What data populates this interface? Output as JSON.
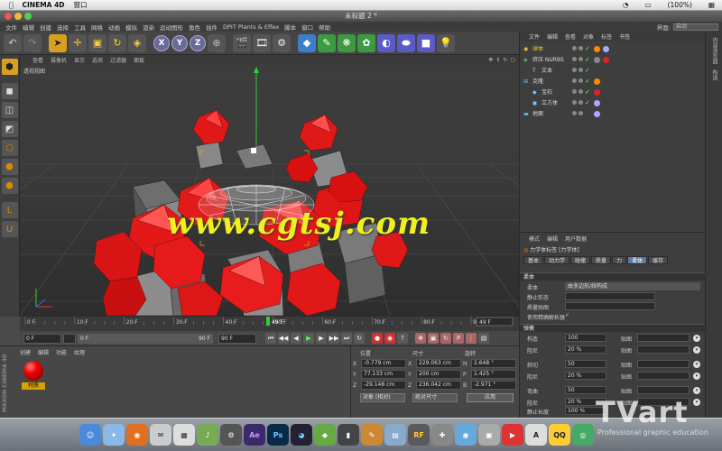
{
  "menubar": {
    "app_name": "CINEMA 4D",
    "window_menu": "窗口",
    "battery": "(100%)"
  },
  "titlebar": {
    "title": "未标题 2 *"
  },
  "c4d_menu": {
    "items": [
      "文件",
      "编辑",
      "创建",
      "选择",
      "工具",
      "网格",
      "动画",
      "模拟",
      "渲染",
      "运动图形",
      "角色",
      "插件",
      "DPIT Plants & Effex",
      "脚本",
      "窗口",
      "帮助"
    ],
    "layout_label": "界面:",
    "layout_value": "启动"
  },
  "viewport": {
    "menu": [
      "查看",
      "摄像机",
      "显示",
      "选项",
      "过滤器",
      "面板"
    ],
    "label": "透视视图"
  },
  "timeline": {
    "ticks": [
      "0 F",
      "10 F",
      "20 F",
      "30 F",
      "40 F",
      "50 F",
      "60 F",
      "70 F",
      "80 F",
      "90"
    ],
    "current_frame": "49 F",
    "end_frame": "49 F",
    "current_frame_value": 49,
    "max_frame": 90
  },
  "transport": {
    "start": "0 F",
    "min": "0 F",
    "max": "90 F",
    "end": "90 F"
  },
  "material_manager": {
    "menu": [
      "创建",
      "编辑",
      "功能",
      "纹理"
    ],
    "material_name": "材质",
    "logo": "MAXON CINEMA 4D"
  },
  "coordinates": {
    "headers": {
      "position": "位置",
      "size": "尺寸",
      "rotation": "旋转"
    },
    "rows": [
      {
        "axis": "X",
        "pos": "-0.779 cm",
        "size": "229.063 cm",
        "rot_axis": "H",
        "rot": "2.648 °"
      },
      {
        "axis": "Y",
        "pos": "77.133 cm",
        "size": "200 cm",
        "rot_axis": "P",
        "rot": "1.425 °"
      },
      {
        "axis": "Z",
        "pos": "-29.148 cm",
        "size": "236.042 cm",
        "rot_axis": "B",
        "rot": "-2.971 °"
      }
    ],
    "mode_select": "对象 (相对)",
    "size_select": "绝对尺寸",
    "apply": "应用"
  },
  "object_manager": {
    "menu": [
      "文件",
      "编辑",
      "查看",
      "对象",
      "标签",
      "书签"
    ],
    "objects": [
      {
        "name": "球体",
        "indent": 0,
        "highlight": true
      },
      {
        "name": "挤压 NURBS",
        "indent": 0,
        "highlight": false
      },
      {
        "name": "文本",
        "indent": 1,
        "highlight": false
      },
      {
        "name": "克隆",
        "indent": 0,
        "highlight": false
      },
      {
        "name": "宝石",
        "indent": 1,
        "highlight": false
      },
      {
        "name": "立方体",
        "indent": 1,
        "highlight": false
      },
      {
        "name": "地面",
        "indent": 0,
        "highlight": false
      }
    ]
  },
  "attribute_manager": {
    "menu": [
      "模式",
      "编辑",
      "用户数据"
    ],
    "title": "力学体标签 [力学体]",
    "tabs": [
      "基本",
      "动力学",
      "碰撞",
      "质量",
      "力",
      "柔体",
      "缓存"
    ],
    "active_tab": "柔体",
    "section1": "柔体",
    "soft_label": "柔体",
    "soft_value": "由多边形/线构成",
    "static_shape": "静止形态",
    "mass_map": "质量贴图",
    "use_precise": "使用精确解析器",
    "section2": "弹簧",
    "springs": [
      {
        "label": "构造",
        "value": "100",
        "map": "贴图"
      },
      {
        "label": "阻尼",
        "value": "20 %",
        "map": "贴图"
      },
      {
        "label": "斜切",
        "value": "50",
        "map": "贴图"
      },
      {
        "label": "阻尼",
        "value": "20 %",
        "map": "贴图"
      },
      {
        "label": "弯曲",
        "value": "50",
        "map": "贴图"
      },
      {
        "label": "阻尼",
        "value": "20 %",
        "map": "贴图"
      }
    ],
    "rest_length": "静止长度",
    "rest_value": "100 %"
  },
  "right_sidebar": [
    "内容浏览器",
    "构造"
  ],
  "watermark": "www.cgtsj.com",
  "tvart": {
    "logo": "TVart",
    "sub": "Professional graphic education"
  },
  "dock_labels": [
    "Ae",
    "Ps",
    "RF",
    "QQ"
  ]
}
